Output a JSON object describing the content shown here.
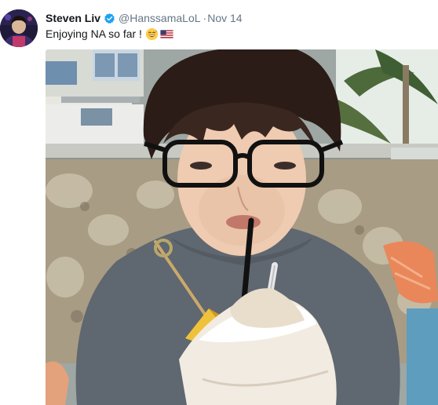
{
  "tweet": {
    "author_name": "Steven Liv",
    "handle": "@HanssamaLoL",
    "separator": "·",
    "date": "Nov 14",
    "text": "Enjoying NA so far !",
    "emojis": [
      "grinning-sweat-emoji",
      "us-flag-emoji"
    ],
    "verified": true,
    "avatar_icon": "avatar-photo",
    "media_icon": "photo-person-drinking-coconut"
  },
  "colors": {
    "name": "#14171a",
    "secondary": "#657786",
    "verified_badge": "#1da1f2",
    "background": "#ffffff"
  }
}
